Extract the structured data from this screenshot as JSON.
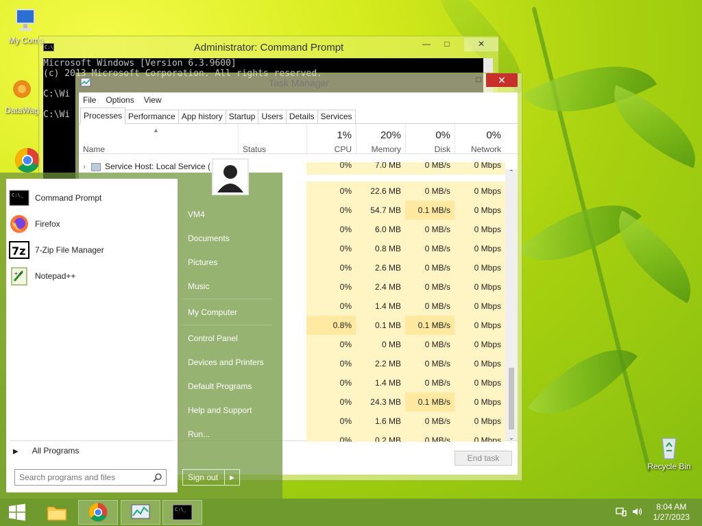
{
  "desktop": {
    "icons": [
      {
        "label": "My Comp",
        "icon": "computer-icon"
      },
      {
        "label": "DataWag",
        "icon": "datawag-icon"
      },
      {
        "label": "",
        "icon": "chrome-icon"
      },
      {
        "label": "Recycle Bin",
        "icon": "recycle-bin-icon"
      }
    ]
  },
  "cmd": {
    "title": "Administrator:  Command Prompt",
    "lines": [
      "Microsoft Windows [Version 6.3.9600]",
      "(c) 2013 Microsoft Corporation. All rights reserved.",
      "",
      "C:\\Wi",
      "",
      "C:\\Wi"
    ]
  },
  "taskmgr": {
    "title": "Task Manager",
    "menu": [
      "File",
      "Options",
      "View"
    ],
    "tabs": [
      "Processes",
      "Performance",
      "App history",
      "Startup",
      "Users",
      "Details",
      "Services"
    ],
    "active_tab": "Processes",
    "columns": {
      "name": "Name",
      "status": "Status",
      "cpu": {
        "pct": "1%",
        "label": "CPU"
      },
      "memory": {
        "pct": "20%",
        "label": "Memory"
      },
      "disk": {
        "pct": "0%",
        "label": "Disk"
      },
      "network": {
        "pct": "0%",
        "label": "Network"
      }
    },
    "first_row_name": "Service Host: Local Service (",
    "rows": [
      {
        "cpu": "0%",
        "mem": "7.0 MB",
        "disk": "0 MB/s",
        "net": "0 Mbps"
      },
      {
        "cpu": "0%",
        "mem": "22.6 MB",
        "disk": "0 MB/s",
        "net": "0 Mbps"
      },
      {
        "cpu": "0%",
        "mem": "54.7 MB",
        "disk": "0.1 MB/s",
        "net": "0 Mbps"
      },
      {
        "cpu": "0%",
        "mem": "6.0 MB",
        "disk": "0 MB/s",
        "net": "0 Mbps"
      },
      {
        "cpu": "0%",
        "mem": "0.8 MB",
        "disk": "0 MB/s",
        "net": "0 Mbps"
      },
      {
        "cpu": "0%",
        "mem": "2.6 MB",
        "disk": "0 MB/s",
        "net": "0 Mbps"
      },
      {
        "cpu": "0%",
        "mem": "2.4 MB",
        "disk": "0 MB/s",
        "net": "0 Mbps"
      },
      {
        "cpu": "0%",
        "mem": "1.4 MB",
        "disk": "0 MB/s",
        "net": "0 Mbps"
      },
      {
        "cpu": "0.8%",
        "mem": "0.1 MB",
        "disk": "0.1 MB/s",
        "net": "0 Mbps"
      },
      {
        "cpu": "0%",
        "mem": "0 MB",
        "disk": "0 MB/s",
        "net": "0 Mbps"
      },
      {
        "cpu": "0%",
        "mem": "2.2 MB",
        "disk": "0 MB/s",
        "net": "0 Mbps"
      },
      {
        "cpu": "0%",
        "mem": "1.4 MB",
        "disk": "0 MB/s",
        "net": "0 Mbps"
      },
      {
        "cpu": "0%",
        "mem": "24.3 MB",
        "disk": "0.1 MB/s",
        "net": "0 Mbps"
      },
      {
        "cpu": "0%",
        "mem": "1.6 MB",
        "disk": "0 MB/s",
        "net": "0 Mbps"
      },
      {
        "cpu": "0%",
        "mem": "0.2 MB",
        "disk": "0 MB/s",
        "net": "0 Mbps"
      }
    ],
    "end_task": "End task"
  },
  "start_menu": {
    "programs": [
      {
        "label": "Command Prompt",
        "icon": "cmd-icon"
      },
      {
        "label": "Firefox",
        "icon": "firefox-icon"
      },
      {
        "label": "7-Zip File Manager",
        "icon": "7zip-icon"
      },
      {
        "label": "Notepad++",
        "icon": "notepadpp-icon"
      }
    ],
    "all_programs": "All Programs",
    "search_placeholder": "Search programs and files",
    "right_links": [
      "VM4",
      "Documents",
      "Pictures",
      "Music",
      "My Computer",
      "Control Panel",
      "Devices and Printers",
      "Default Programs",
      "Help and Support",
      "Run..."
    ],
    "sign_out": "Sign out"
  },
  "taskbar": {
    "time": "8:04 AM",
    "date": "1/27/2023"
  },
  "colors": {
    "taskbar": "#6f9a2e",
    "close_button": "#c7302b",
    "cpu_column": "#fff4c4"
  }
}
